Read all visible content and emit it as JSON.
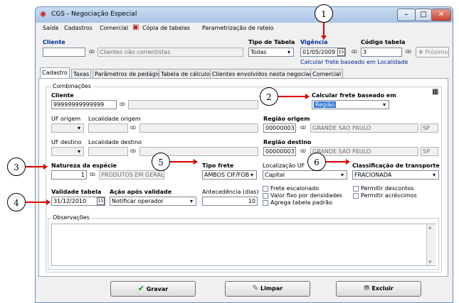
{
  "window": {
    "title": "CGS - Negociação Especial"
  },
  "menu": [
    "Saída",
    "Cadastros",
    "Comercial",
    "Cópia de tabelas",
    "Parametrização de rateio"
  ],
  "header": {
    "cliente_label": "Cliente",
    "cliente_value": "",
    "cliente_desc": "Clientes não correntistas",
    "tipo_tabela_label": "Tipo de Tabela",
    "tipo_tabela_value": "Todas",
    "vigencia_label": "Vigência",
    "vigencia_value": "01/05/2009",
    "codigo_tabela_label": "Código tabela",
    "codigo_tabela_value": "3",
    "proximo_label": "Próximo",
    "info_text": "Calcular frete baseado em Localidade"
  },
  "tabs": [
    "Cadastro",
    "Taxas",
    "Parâmetros de pedágio",
    "Tabela de cálculo",
    "Clientes envolvidos nesta negociação",
    "Comercial"
  ],
  "combinacoes": {
    "group_label": "Combinações",
    "cliente_label": "Cliente",
    "cliente_value": "99999999999999",
    "calc_frete_label": "Calcular frete baseado em",
    "calc_frete_value": "Região",
    "uf_origem_label": "UF origem",
    "loc_origem_label": "Localidade origem",
    "regiao_origem_label": "Região origem",
    "regiao_origem_code": "00000003",
    "regiao_origem_name": "GRANDE SAO PAULO",
    "regiao_origem_uf": "SP",
    "uf_destino_label": "UF destino",
    "loc_destino_label": "Localidade destino",
    "regiao_destino_label": "Região destino",
    "regiao_destino_code": "00000003",
    "regiao_destino_name": "GRANDE SAO PAULO",
    "regiao_destino_uf": "SP",
    "natureza_label": "Natureza da espécie",
    "natureza_code": "1",
    "natureza_desc": "PRODUTOS EM GERAL",
    "tipo_frete_label": "Tipo frete",
    "tipo_frete_value": "AMBOS CIF/FOB",
    "localizacao_uf_label": "Localização UF",
    "localizacao_uf_value": "Capital",
    "classificacao_label": "Classificação de transporte",
    "classificacao_value": "FRACIONADA",
    "validade_label": "Validade tabela",
    "validade_value": "31/12/2010",
    "acao_label": "Ação após validade",
    "acao_value": "Notificar operador",
    "antecedencia_label": "Antecedência (dias)",
    "antecedencia_value": "10",
    "checkboxes": [
      "Frete escalonado",
      "Valor fixo por densidades",
      "Agrega tabela padrão",
      "Permitir descontos",
      "Permitir acréscimos"
    ],
    "observacoes_label": "Observações"
  },
  "buttons": {
    "gravar": "Gravar",
    "limpar": "Limpar",
    "excluir": "Excluir"
  },
  "callouts": [
    "1",
    "2",
    "3",
    "4",
    "5",
    "6"
  ],
  "colors": {
    "accent_blue": "#00289a",
    "arrow_red": "#e00000",
    "highlight": "#3375d6"
  }
}
